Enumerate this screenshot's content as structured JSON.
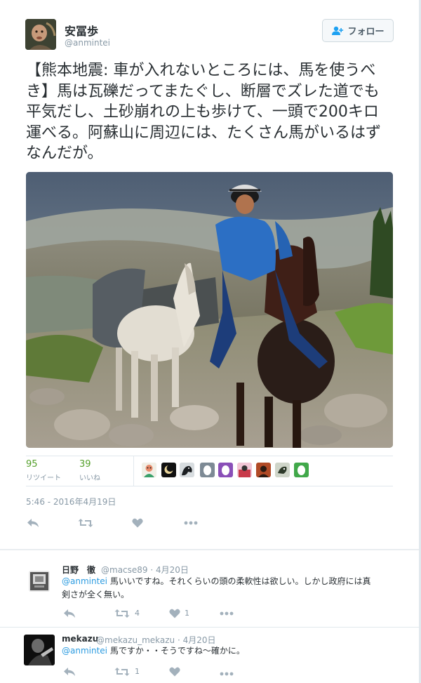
{
  "tweet": {
    "display_name": "安冨歩",
    "handle": "@anmintei",
    "follow_label": "フォロー",
    "text": "【熊本地震: 車が入れないところには、馬を使うべき】馬は瓦礫だってまたぐし、断層でズレた道でも平気だし、土砂崩れの上も歩けて、一頭で200キロ運べる。阿蘇山に周辺には、たくさん馬がいるはずなんだが。",
    "retweets_count": "95",
    "retweets_label": "リツイート",
    "likes_count": "39",
    "likes_label": "いいね",
    "timestamp": "5:46 - 2016年4月19日",
    "icons": [
      "reply-icon",
      "retweet-icon",
      "like-icon",
      "more-icon"
    ]
  },
  "likers": [
    "liker-avatar-1",
    "liker-avatar-2",
    "liker-avatar-3",
    "default-egg-avatar",
    "default-egg-avatar",
    "liker-avatar-6",
    "liker-avatar-7",
    "liker-avatar-8",
    "default-egg-avatar"
  ],
  "replies": [
    {
      "name": "日野　徹",
      "handle": "@macse89",
      "date": "4月20日",
      "mention": "@anmintei",
      "text_line1": " 馬いいですね。それくらいの頭の柔軟性は欲しい。しかし政府には真",
      "text_line2": "剣さが全く無い。",
      "retweet_count": "4",
      "like_count": "1"
    },
    {
      "name": "mekazu",
      "handle": "@mekazu_mekazu",
      "date": "4月20日",
      "mention": "@anmintei",
      "text_line1": " 馬ですか・・そうですね〜確かに。",
      "retweet_count": "1"
    }
  ],
  "colors": {
    "accent_green": "#55a02c",
    "mention_blue": "#2b9be0",
    "muted_text": "#8899a6",
    "divider": "#e1e8ed"
  }
}
